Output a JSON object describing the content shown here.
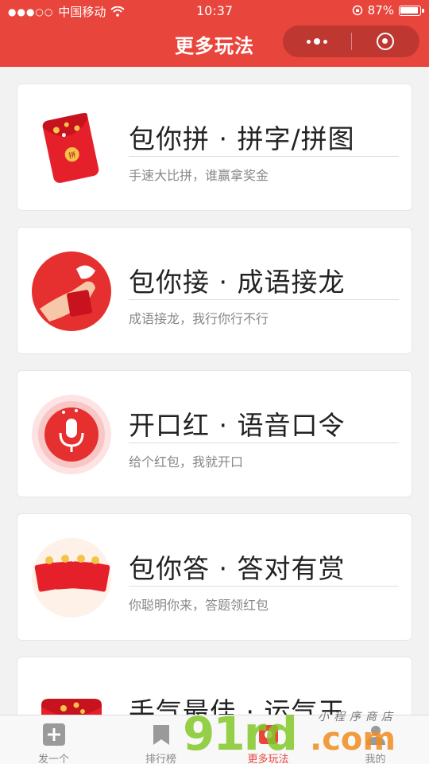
{
  "status": {
    "carrier": "中国移动",
    "time": "10:37",
    "battery": "87%"
  },
  "nav": {
    "title": "更多玩法"
  },
  "cards": [
    {
      "title": "包你拼 · 拼字/拼图",
      "subtitle": "手速大比拼，谁赢拿奖金",
      "icon": "jigsaw-red-packet-icon"
    },
    {
      "title": "包你接 · 成语接龙",
      "subtitle": "成语接龙，我行你行不行",
      "icon": "hand-red-packet-icon"
    },
    {
      "title": "开口红 · 语音口令",
      "subtitle": "给个红包，我就开口",
      "icon": "microphone-icon"
    },
    {
      "title": "包你答 · 答对有赏",
      "subtitle": "你聪明你来，答题领红包",
      "icon": "abcd-red-packets-icon"
    },
    {
      "title": "手气最佳 · 运气王",
      "subtitle": "",
      "icon": "lucky-red-packet-icon"
    }
  ],
  "tabbar": [
    {
      "label": "发一个",
      "icon": "plus-icon"
    },
    {
      "label": "排行榜",
      "icon": "bookmark-icon"
    },
    {
      "label": "更多玩法",
      "icon": "more-icon"
    },
    {
      "label": "我的",
      "icon": "user-icon"
    }
  ],
  "watermark": {
    "brand": "91rd",
    "domain": ".com",
    "tagline": "小程序商店"
  },
  "colors": {
    "brand_red": "#e8453c",
    "text_dark": "#222222",
    "text_muted": "#888888"
  }
}
